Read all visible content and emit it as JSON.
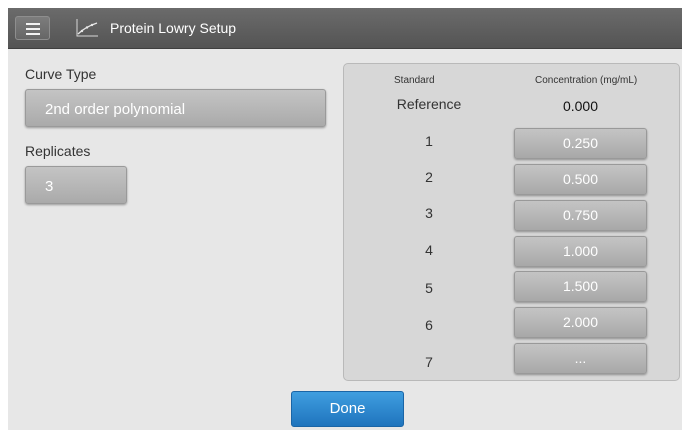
{
  "header": {
    "title": "Protein Lowry Setup",
    "menu_icon": "hamburger-menu-icon",
    "app_icon": "standard-curve-icon"
  },
  "left": {
    "curve_type_label": "Curve Type",
    "curve_type_value": "2nd order polynomial",
    "replicates_label": "Replicates",
    "replicates_value": "3"
  },
  "table": {
    "col_standard": "Standard",
    "col_concentration": "Concentration (mg/mL)",
    "reference": {
      "label": "Reference",
      "value": "0.000"
    },
    "rows": [
      {
        "standard": "1",
        "value": "0.250"
      },
      {
        "standard": "2",
        "value": "0.500"
      },
      {
        "standard": "3",
        "value": "0.750"
      },
      {
        "standard": "4",
        "value": "1.000"
      },
      {
        "standard": "5",
        "value": "1.500"
      },
      {
        "standard": "6",
        "value": "2.000"
      },
      {
        "standard": "7",
        "value": "..."
      }
    ]
  },
  "footer": {
    "done_label": "Done"
  },
  "colors": {
    "topbar": "#5e5e5e",
    "background": "#e7e7e7",
    "panel": "#d7d7d7",
    "gray_button": "#b5b5b5",
    "done_button": "#2a84cf"
  }
}
